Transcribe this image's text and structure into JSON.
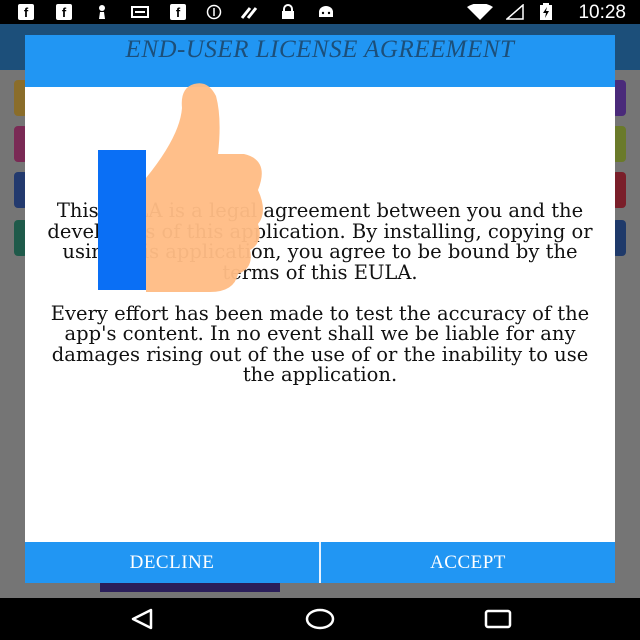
{
  "status_bar": {
    "time": "10:28",
    "notification_icons": [
      "facebook-icon",
      "facebook-icon",
      "pawn-icon",
      "message-icon",
      "facebook-icon",
      "circle-icon",
      "feedly-icon",
      "lock-icon",
      "android-icon"
    ],
    "system_icons": [
      "wifi-icon",
      "signal-icon",
      "battery-charging-icon"
    ]
  },
  "dialog": {
    "title": "END-USER LICENSE AGREEMENT",
    "paragraph_1": "This EULA is a legal agreement between you and the developers of this application. By installing, copying or using this application, you agree to be bound by the terms of this EULA.",
    "paragraph_2": "Every effort has been made to test the accuracy of the app's content. In no event shall we be liable for any damages rising out of the use of or the inability to use the application.",
    "decline_label": "DECLINE",
    "accept_label": "ACCEPT"
  },
  "overlay": {
    "icon": "thumbs-up-icon"
  },
  "nav_bar": {
    "icons": [
      "back-icon",
      "home-icon",
      "recents-icon"
    ]
  },
  "colors": {
    "dialog_accent": "#2196f3",
    "title_text": "#1c4f7a",
    "thumb_skin": "#ffbc85",
    "thumb_cuff": "#0a6ff5"
  }
}
